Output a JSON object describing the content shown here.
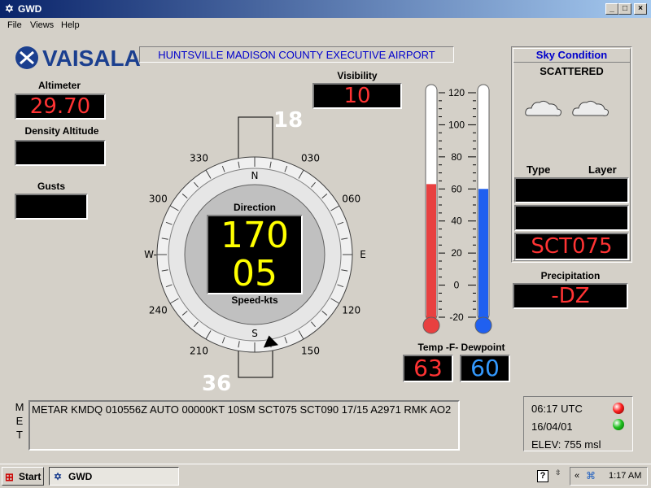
{
  "window": {
    "title": "GWD",
    "controls": {
      "minimize": "_",
      "maximize": "□",
      "close": "×"
    }
  },
  "menu": {
    "items": [
      "File",
      "Views",
      "Help"
    ]
  },
  "logo": {
    "text": "VAISALA"
  },
  "airport": {
    "name": "HUNTSVILLE MADISON COUNTY EXECUTIVE AIRPORT"
  },
  "altimeter": {
    "label": "Altimeter",
    "value": "29.70"
  },
  "density_altitude": {
    "label": "Density Altitude",
    "value": ""
  },
  "gusts": {
    "label": "Gusts",
    "value": ""
  },
  "visibility": {
    "label": "Visibility",
    "value": "10"
  },
  "wind": {
    "runway_top": "18",
    "runway_bottom": "36",
    "direction_label": "Direction",
    "direction": "170",
    "speed": "05",
    "speed_label": "Speed-kts",
    "compass_labels": [
      "N",
      "030",
      "060",
      "E",
      "120",
      "150",
      "S",
      "210",
      "240",
      "W-",
      "300",
      "330"
    ],
    "direction_degrees": 170
  },
  "thermometers": {
    "scale": [
      "120",
      "100",
      "80",
      "60",
      "40",
      "20",
      "0",
      "-20"
    ],
    "min": -20,
    "max": 120,
    "temp": 63,
    "dewpoint": 60,
    "label": "Temp -F- Dewpoint",
    "temp_display": "63",
    "dewpoint_display": "60",
    "temp_color": "#e84040",
    "dewpoint_color": "#2060f0"
  },
  "sky": {
    "title": "Sky Condition",
    "condition": "SCATTERED",
    "type_label": "Type",
    "layer_label": "Layer",
    "layers": [
      "",
      "",
      "SCT075"
    ]
  },
  "precipitation": {
    "label": "Precipitation",
    "value": "-DZ"
  },
  "met": {
    "side_label": [
      "M",
      "E",
      "T"
    ],
    "text": "METAR KMDQ 010556Z AUTO 00000KT 10SM SCT075 SCT090 17/15 A2971 RMK AO2"
  },
  "status": {
    "time": "06:17 UTC",
    "date": "16/04/01",
    "elevation": "ELEV: 755 msl",
    "led1_color": "#ff2020",
    "led2_color": "#20c020"
  },
  "taskbar": {
    "start": "Start",
    "task": "GWD",
    "help": "?",
    "arrows": "«",
    "clock": "1:17 AM"
  },
  "colors": {
    "lcd_red": "#ff3333",
    "lcd_yellow": "#ffff00",
    "lcd_blue": "#3399ff",
    "header_blue": "#0000cc"
  }
}
